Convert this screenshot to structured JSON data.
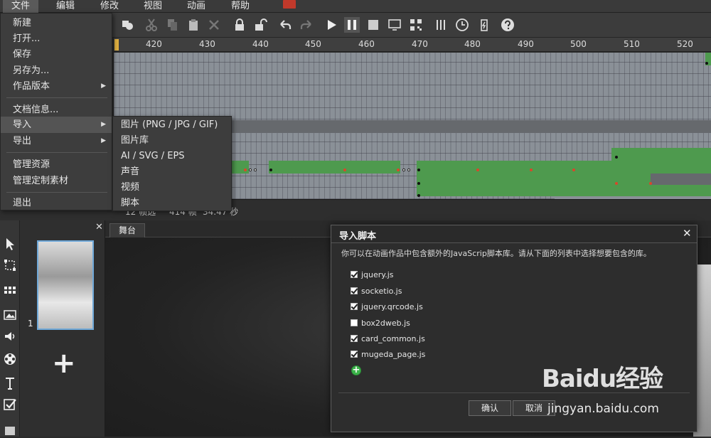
{
  "menubar": {
    "items": [
      "文件",
      "编辑",
      "修改",
      "视图",
      "动画",
      "帮助"
    ]
  },
  "ruler": {
    "ticks": [
      "420",
      "430",
      "440",
      "450",
      "460",
      "470",
      "480",
      "490",
      "500",
      "510",
      "520"
    ]
  },
  "timeline_footer": {
    "layers": "12 帧选",
    "frames": "414 帧",
    "fps": "34.47 秒"
  },
  "file_menu": {
    "new": "新建",
    "open": "打开...",
    "save": "保存",
    "save_as": "另存为...",
    "version": "作品版本",
    "doc_info": "文档信息...",
    "import": "导入",
    "export": "导出",
    "manage_assets": "管理资源",
    "manage_custom": "管理定制素材",
    "exit": "退出"
  },
  "import_submenu": {
    "image": "图片 (PNG / JPG / GIF)",
    "image_library": "图片库",
    "vector": "AI / SVG / EPS",
    "sound": "声音",
    "video": "视频",
    "script": "脚本"
  },
  "page_panel": {
    "page_number": "1",
    "add_label": "+"
  },
  "stage": {
    "tab_label": "舞台"
  },
  "dialog": {
    "title": "导入脚本",
    "description": "你可以在动画作品中包含额外的JavaScrip脚本库。请从下面的列表中选择想要包含的库。",
    "libraries": [
      {
        "name": "jquery.js",
        "checked": true
      },
      {
        "name": "socketio.js",
        "checked": true
      },
      {
        "name": "jquery.qrcode.js",
        "checked": true
      },
      {
        "name": "box2dweb.js",
        "checked": false
      },
      {
        "name": "card_common.js",
        "checked": true
      },
      {
        "name": "mugeda_page.js",
        "checked": true
      }
    ],
    "confirm": "确认",
    "cancel": "取消"
  },
  "watermark": {
    "brand": "Baidu经验",
    "url": "jingyan.baidu.com"
  },
  "colors": {
    "accent_blue": "#6fa8d8",
    "keyframe_green": "#4e9a4e",
    "keyframe_red": "#d9472b",
    "add_green": "#3cb34a"
  }
}
